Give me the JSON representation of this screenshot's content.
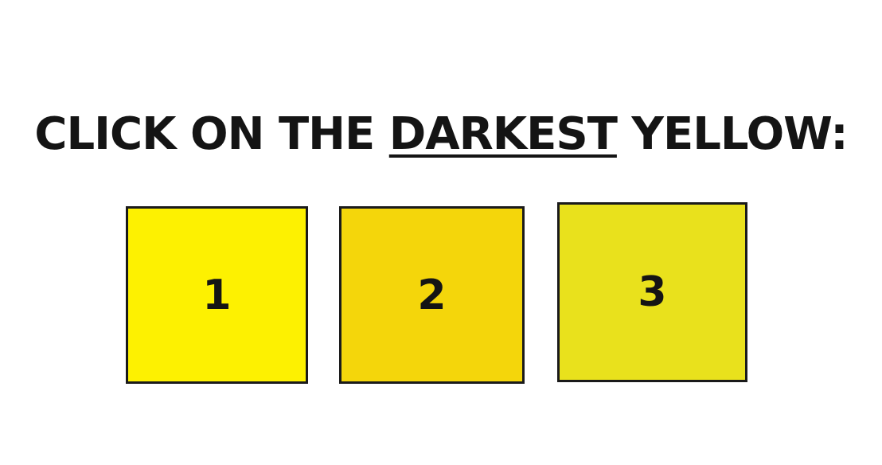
{
  "prompt": {
    "before": "CLICK ON THE ",
    "emphasis": "DARKEST",
    "after": " YELLOW:"
  },
  "tiles": [
    {
      "label": "1",
      "color": "#fdf101"
    },
    {
      "label": "2",
      "color": "#f4d60b"
    },
    {
      "label": "3",
      "color": "#e9e11c"
    }
  ]
}
